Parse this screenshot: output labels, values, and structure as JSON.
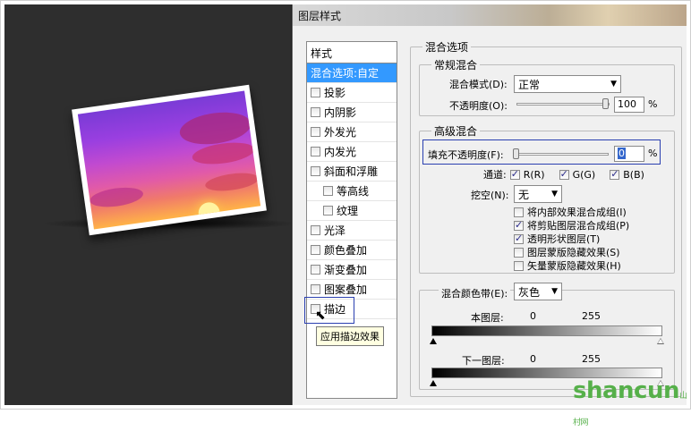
{
  "window": {
    "title": "图层样式"
  },
  "style_panel": {
    "header": "样式",
    "items": [
      {
        "label": "混合选项:自定",
        "selected": true,
        "checkbox": false,
        "sub": false
      },
      {
        "label": "投影",
        "checkbox": true,
        "sub": false
      },
      {
        "label": "内阴影",
        "checkbox": true,
        "sub": false
      },
      {
        "label": "外发光",
        "checkbox": true,
        "sub": false
      },
      {
        "label": "内发光",
        "checkbox": true,
        "sub": false
      },
      {
        "label": "斜面和浮雕",
        "checkbox": true,
        "sub": false
      },
      {
        "label": "等高线",
        "checkbox": true,
        "sub": true
      },
      {
        "label": "纹理",
        "checkbox": true,
        "sub": true
      },
      {
        "label": "光泽",
        "checkbox": true,
        "sub": false
      },
      {
        "label": "颜色叠加",
        "checkbox": true,
        "sub": false
      },
      {
        "label": "渐变叠加",
        "checkbox": true,
        "sub": false
      },
      {
        "label": "图案叠加",
        "checkbox": true,
        "sub": false
      },
      {
        "label": "描边",
        "checkbox": true,
        "sub": false
      }
    ],
    "tooltip": "应用描边效果"
  },
  "blend_options": {
    "title": "混合选项",
    "general": {
      "title": "常规混合",
      "mode_label": "混合模式(D):",
      "mode_value": "正常",
      "opacity_label": "不透明度(O):",
      "opacity_value": "100",
      "opacity_unit": "%",
      "opacity_fraction": 1.0
    },
    "advanced": {
      "title": "高级混合",
      "fill_label": "填充不透明度(F):",
      "fill_value": "0",
      "fill_unit": "%",
      "fill_fraction": 0.0,
      "channels_label": "通道:",
      "channels": [
        {
          "label": "R(R)",
          "checked": true
        },
        {
          "label": "G(G)",
          "checked": true
        },
        {
          "label": "B(B)",
          "checked": true
        }
      ],
      "knockout_label": "挖空(N):",
      "knockout_value": "无",
      "options": [
        {
          "label": "将内部效果混合成组(I)",
          "checked": false
        },
        {
          "label": "将剪贴图层混合成组(P)",
          "checked": true
        },
        {
          "label": "透明形状图层(T)",
          "checked": true
        },
        {
          "label": "图层蒙版隐藏效果(S)",
          "checked": false
        },
        {
          "label": "矢量蒙版隐藏效果(H)",
          "checked": false
        }
      ]
    },
    "blend_if": {
      "label": "混合颜色带(E):",
      "value": "灰色",
      "this_layer_label": "本图层:",
      "this_layer_low": "0",
      "this_layer_high": "255",
      "under_layer_label": "下一图层:",
      "under_layer_low": "0",
      "under_layer_high": "255"
    }
  },
  "watermark": {
    "text": "shancun",
    "sub": "山村网"
  }
}
